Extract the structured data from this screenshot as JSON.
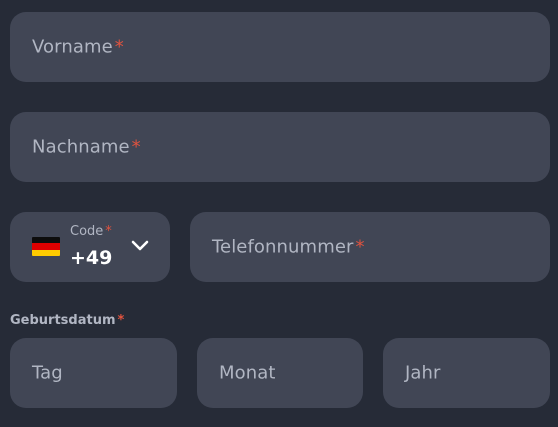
{
  "form": {
    "first_name": {
      "placeholder": "Vorname",
      "required_mark": "*"
    },
    "last_name": {
      "placeholder": "Nachname",
      "required_mark": "*"
    },
    "country_code": {
      "label": "Code",
      "required_mark": "*",
      "value": "+49",
      "flag_icon": "germany-flag-icon",
      "dropdown_icon": "chevron-down-icon"
    },
    "phone": {
      "placeholder": "Telefonnummer",
      "required_mark": "*"
    },
    "birthdate": {
      "label": "Geburtsdatum",
      "required_mark": "*",
      "day_placeholder": "Tag",
      "month_placeholder": "Monat",
      "year_placeholder": "Jahr"
    }
  },
  "colors": {
    "background": "#262b37",
    "field_background": "#414655",
    "placeholder_text": "#b1b6c3",
    "required_mark": "#e0533f",
    "value_text": "#ffffff"
  }
}
